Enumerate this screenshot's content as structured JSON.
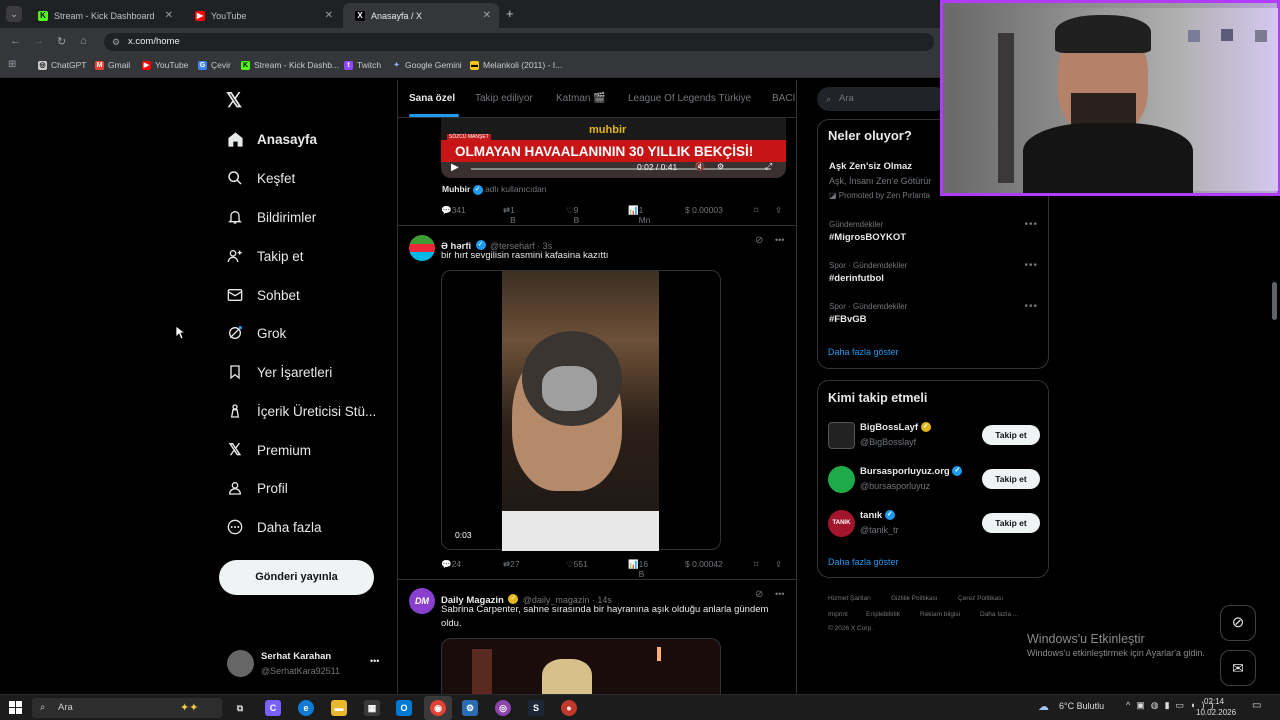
{
  "browser": {
    "tabs": [
      {
        "title": "Stream - Kick Dashboard",
        "favicon": "K"
      },
      {
        "title": "YouTube",
        "favicon": "▶"
      },
      {
        "title": "Anasayfa / X",
        "favicon": "X"
      }
    ],
    "new_tab": "+",
    "url": "x.com/home",
    "bookmarks": [
      "ChatGPT",
      "Gmail",
      "YouTube",
      "Çevir",
      "Stream - Kick Dashb...",
      "Twitch",
      "Google Gemini",
      "Melankoli (2011) - I..."
    ]
  },
  "nav": {
    "items": [
      {
        "label": "Anasayfa",
        "icon": "home-icon"
      },
      {
        "label": "Keşfet",
        "icon": "search-icon"
      },
      {
        "label": "Bildirimler",
        "icon": "bell-icon"
      },
      {
        "label": "Takip et",
        "icon": "add-person-icon"
      },
      {
        "label": "Sohbet",
        "icon": "mail-icon"
      },
      {
        "label": "Grok",
        "icon": "grok-icon"
      },
      {
        "label": "Yer İşaretleri",
        "icon": "bookmark-icon"
      },
      {
        "label": "İçerik Üreticisi Stü...",
        "icon": "creator-icon"
      },
      {
        "label": "Premium",
        "icon": "x-icon"
      },
      {
        "label": "Profil",
        "icon": "person-icon"
      },
      {
        "label": "Daha fazla",
        "icon": "more-circle-icon"
      }
    ],
    "post_button": "Gönderi yayınla",
    "user": {
      "name": "Serhat Karahan",
      "handle": "@SerhatKara92511",
      "more": "•••"
    }
  },
  "feed": {
    "tabs": [
      "Sana özel",
      "Takip ediliyor",
      "Katman 🎬",
      "League Of Legends Türkiye",
      "BACI"
    ],
    "tweet1": {
      "video_source": "SÖZCÜ MANŞET",
      "video_brand": "muhbir",
      "video_headline": "OLMAYAN HAVAALANININ 30 YILLIK BEKÇİSİ!",
      "video_time": "0:02 / 0:41",
      "advertiser": "Muhbir",
      "advertiser_sub": "adlı kullanıcıdan",
      "replies": "341",
      "reposts": "1 B",
      "likes": "9 B",
      "views": "1 Mn",
      "tip": "$ 0.00003"
    },
    "tweet2": {
      "name": "Ə hərfi",
      "handle": "@terseharf · 3s",
      "text": "bir hırt sevgilisin rasmini kafasina kazıttı",
      "duration": "0:03",
      "replies": "24",
      "reposts": "27",
      "likes": "551",
      "views": "16 B",
      "tip": "$ 0.00042"
    },
    "tweet3": {
      "avatar": "DM",
      "name": "Daily Magazin",
      "handle": "@daily_magazin · 14s",
      "text": "Sabrina Carpenter, sahne sırasında bir hayranına aşık olduğu anlarla gündem oldu."
    }
  },
  "right": {
    "search_placeholder": "Ara",
    "trends_title": "Neler oluyor?",
    "promo": {
      "title": "Aşk Zen'siz Olmaz",
      "text": "Aşk, İnsanı Zen'e Götürür",
      "promoted": "Promoted by Zen Pırlanta"
    },
    "trends": [
      {
        "meta": "Gündemdekiler",
        "title": "#MigrosBOYKOT"
      },
      {
        "meta": "Spor · Gündemdekiler",
        "title": "#derinfutbol"
      },
      {
        "meta": "Spor · Gündemdekiler",
        "title": "#FBvGB"
      }
    ],
    "show_more": "Daha fazla göster",
    "follow_title": "Kimi takip etmeli",
    "follow": [
      {
        "name": "BigBossLayf",
        "handle": "@BigBosslayf",
        "button": "Takip et",
        "color": "#222222"
      },
      {
        "name": "Bursasporluyuz.org",
        "handle": "@bursasporluyuz",
        "button": "Takip et",
        "color": "#1faa4a"
      },
      {
        "name": "tanık",
        "handle": "@tanik_tr",
        "button": "Takip et",
        "color": "#a3152a"
      }
    ],
    "follow_more": "Daha fazla göster",
    "footer": [
      "Hizmet Şartları",
      "Gizlilik Politikası",
      "Çerez Politikası",
      "Imprint",
      "Erişilebilirlik",
      "Reklam bilgisi",
      "Daha fazla ...",
      "© 2026 X Corp."
    ]
  },
  "watermark": {
    "title": "Windows'u Etkinleştir",
    "text": "Windows'u etkinleştirmek için Ayarlar'a gidin."
  },
  "taskbar": {
    "search": "Ara",
    "weather": "6°C Bulutlu",
    "time": "02:14",
    "date": "10.02.2026"
  }
}
